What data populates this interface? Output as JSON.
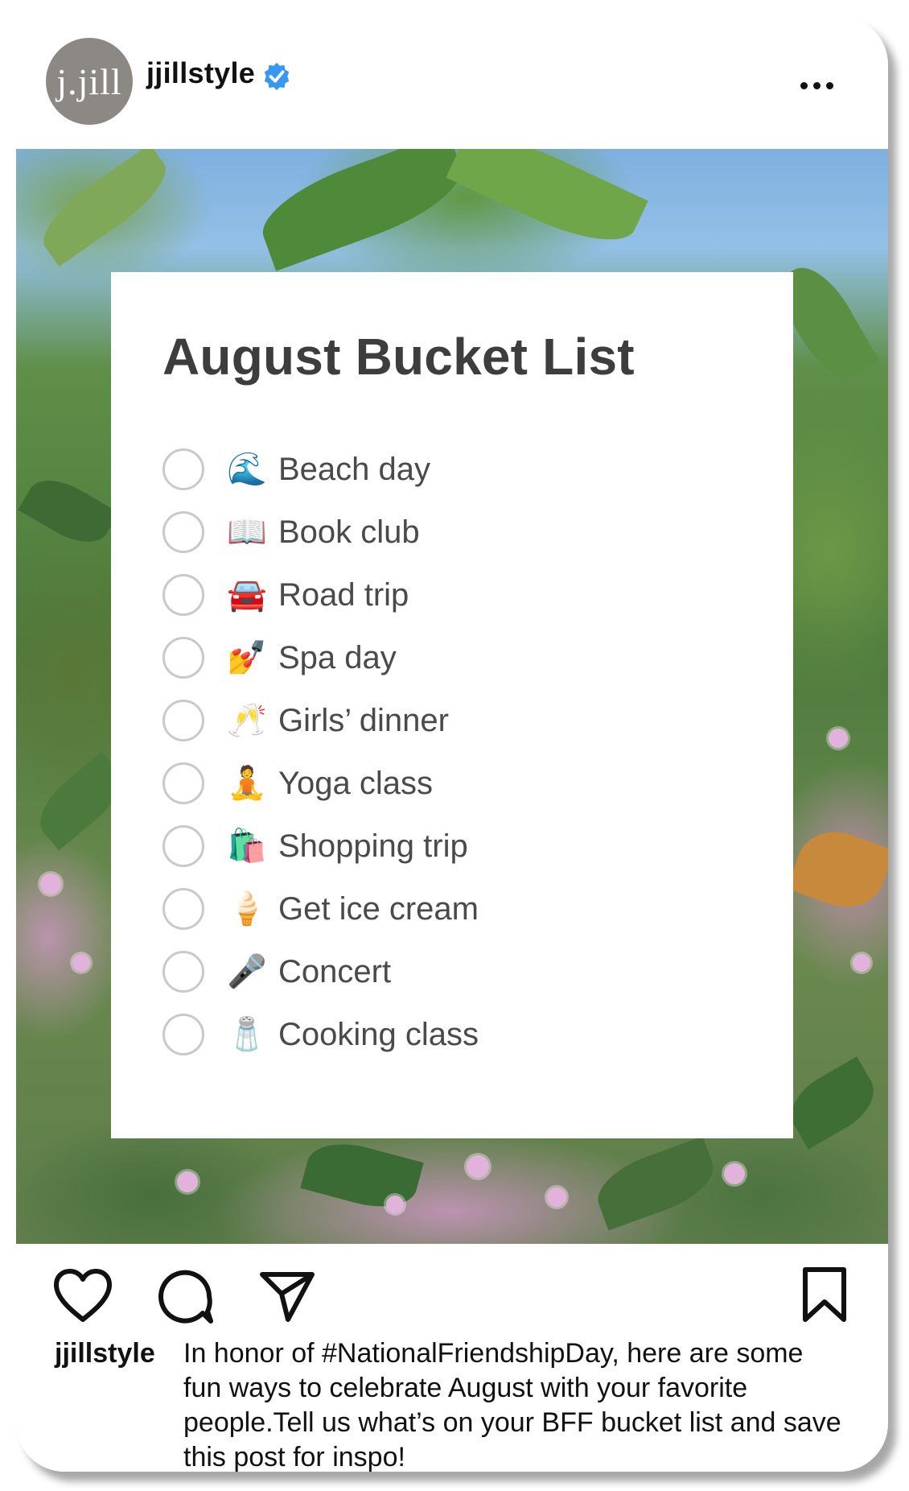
{
  "post": {
    "username": "jjillstyle",
    "avatar_text": "j.jill",
    "verified_icon": "verified-badge-icon",
    "more_icon": "more-options-icon"
  },
  "checklist": {
    "title": "August Bucket List",
    "items": [
      {
        "emoji": "🌊",
        "label": "Beach day",
        "checked": false
      },
      {
        "emoji": "📖",
        "label": "Book club",
        "checked": false
      },
      {
        "emoji": "🚘",
        "label": "Road trip",
        "checked": false
      },
      {
        "emoji": "💅",
        "label": "Spa day",
        "checked": false
      },
      {
        "emoji": "🥂",
        "label": "Girls’ dinner",
        "checked": false
      },
      {
        "emoji": "🧘",
        "label": "Yoga class",
        "checked": false
      },
      {
        "emoji": "🛍️",
        "label": "Shopping trip",
        "checked": false
      },
      {
        "emoji": "🍦",
        "label": "Get ice cream",
        "checked": false
      },
      {
        "emoji": "🎤",
        "label": "Concert",
        "checked": false
      },
      {
        "emoji": "🧂",
        "label": "Cooking class",
        "checked": false
      }
    ]
  },
  "actions": {
    "like_icon": "heart-icon",
    "comment_icon": "comment-icon",
    "share_icon": "send-icon",
    "save_icon": "bookmark-icon"
  },
  "caption": {
    "username": "jjillstyle",
    "text": "In honor of #NationalFriendshipDay, here are some fun ways to celebrate August with your favorite people.Tell us what’s on your BFF bucket list and save this post for inspo!"
  },
  "colors": {
    "verified": "#3897f0",
    "avatar_bg": "#8c8985",
    "panel_title": "#3d3d3d",
    "checkbox_border": "#c9c9c9"
  }
}
